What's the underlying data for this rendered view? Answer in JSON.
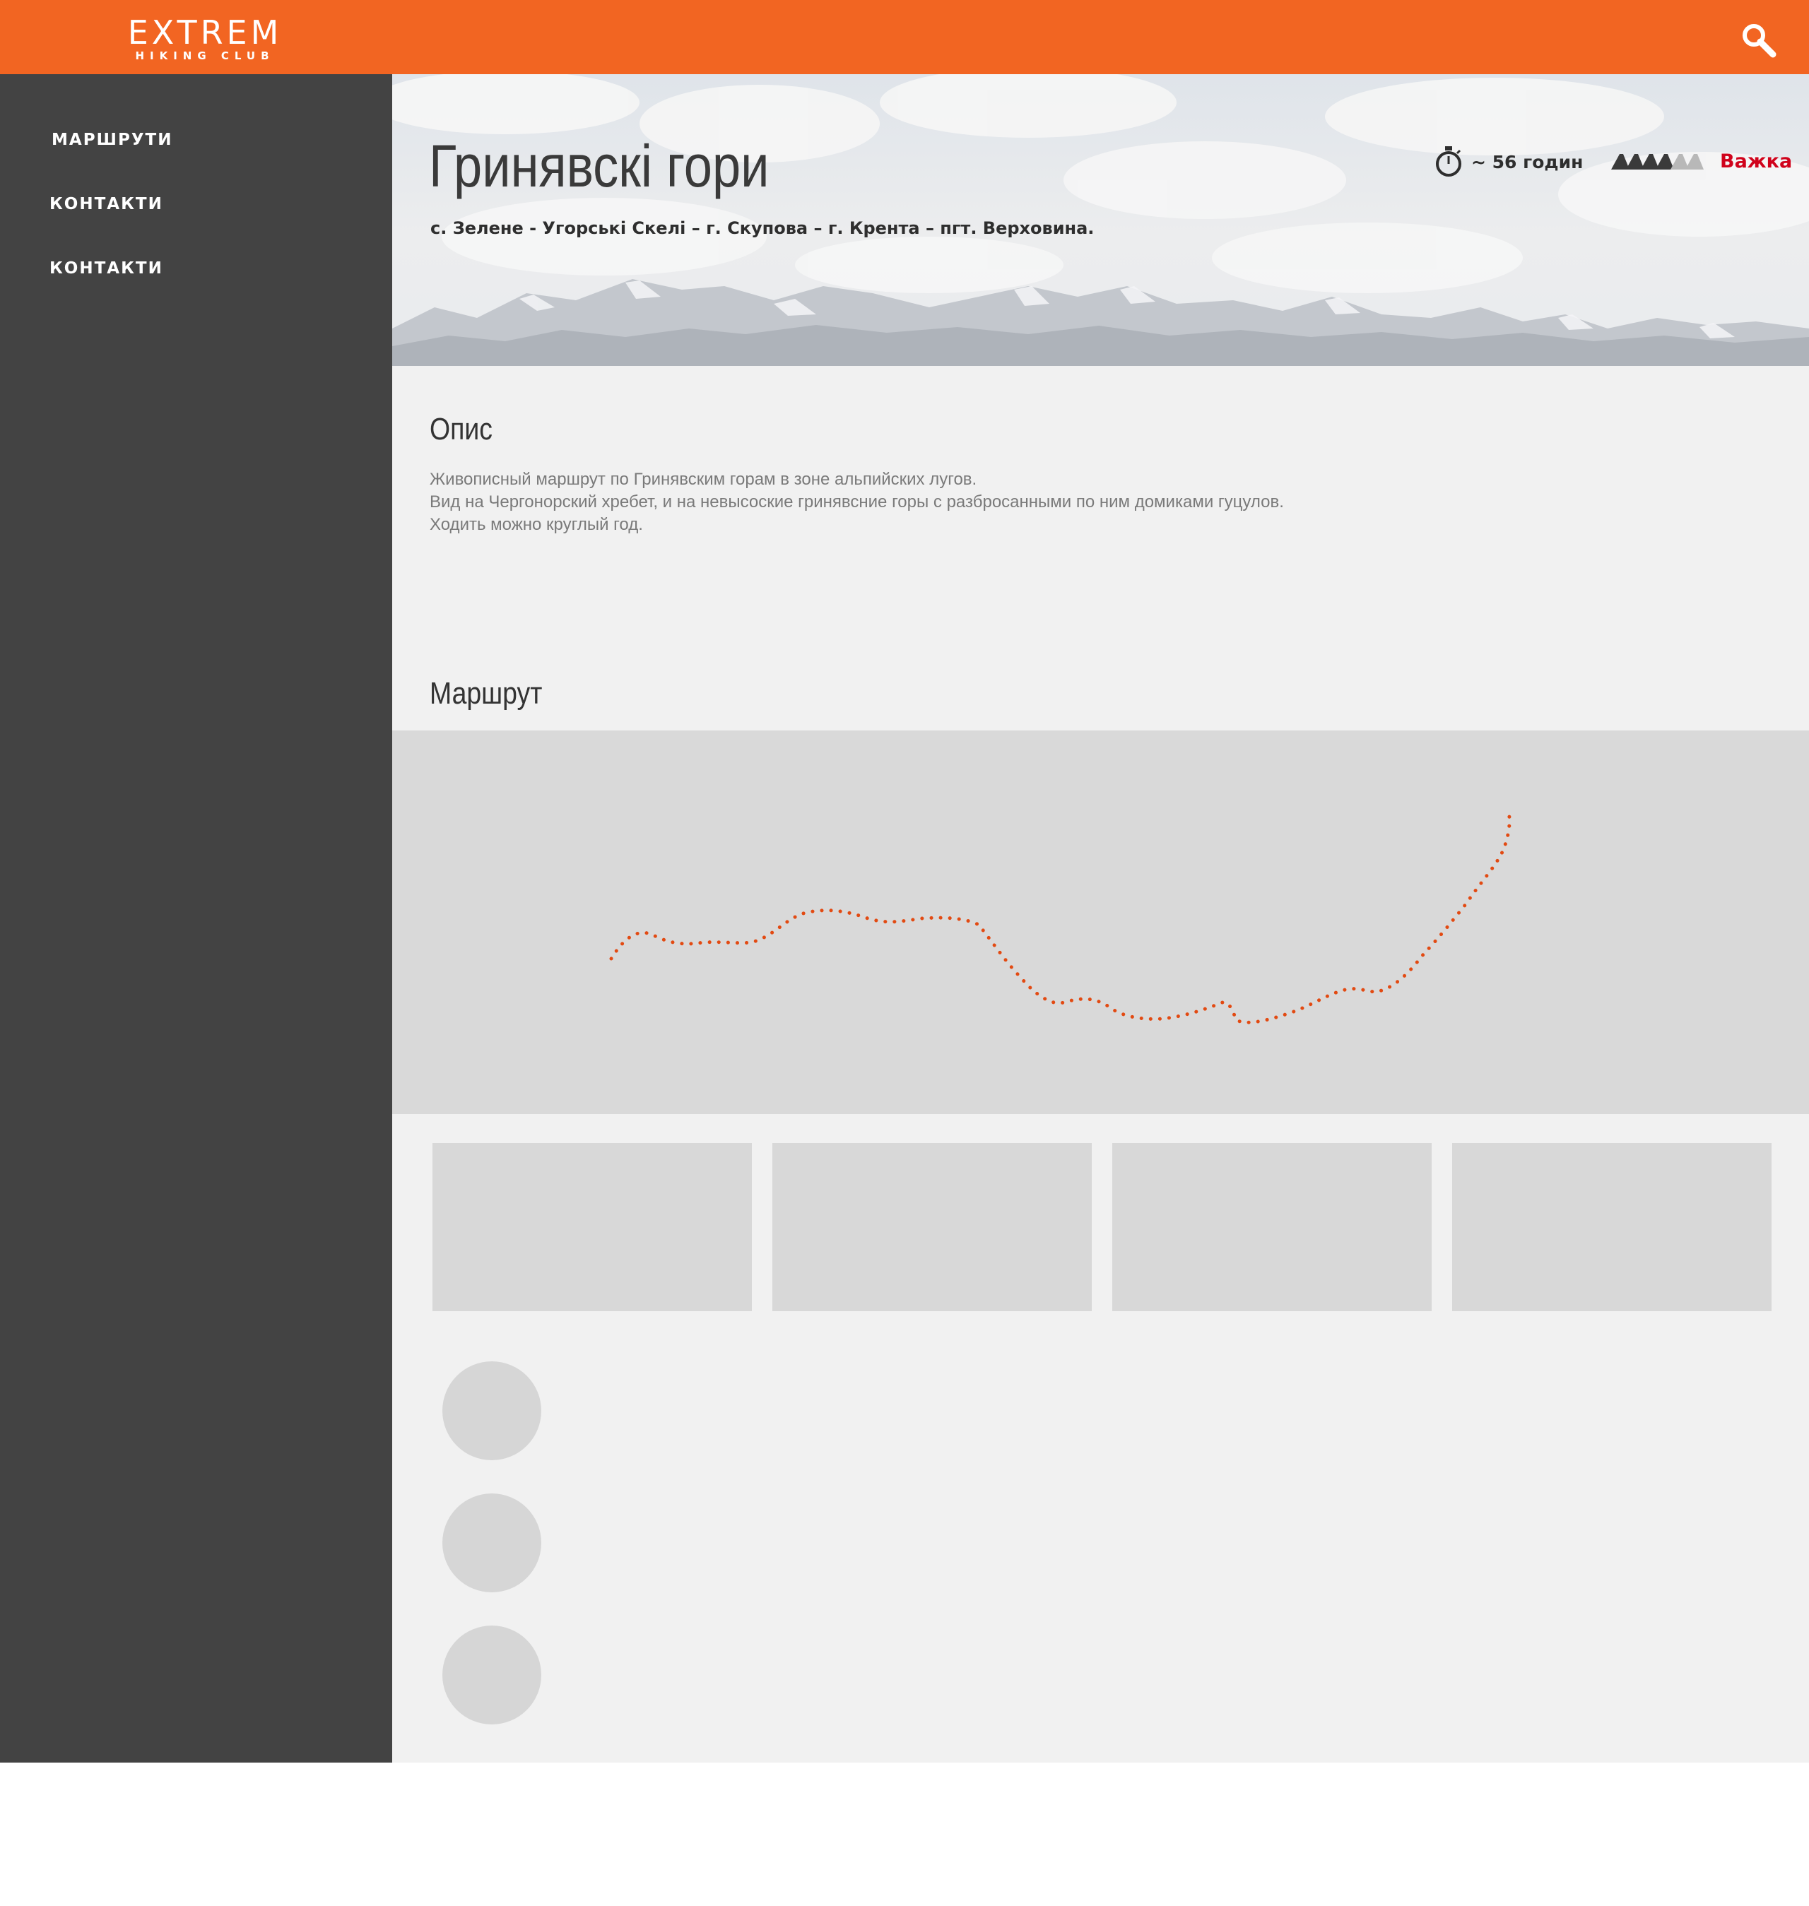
{
  "header": {
    "logo_main": "EXTREM",
    "logo_sub": "HIKING CLUB",
    "search_icon": "search-icon",
    "background": "#f26522"
  },
  "sidebar": {
    "items": [
      {
        "label": "МАРШРУТИ"
      },
      {
        "label": "КОНТАКТИ"
      },
      {
        "label": "КОНТАКТИ"
      }
    ]
  },
  "hero": {
    "title": "Гринявскі гори",
    "route": "с. Зелене - Угорські Скелі – г. Скупова – г. Крента – пгт. Верховина.",
    "time": "~ 56 годин",
    "time_icon": "stopwatch-icon",
    "difficulty_label": "Важка",
    "difficulty_level": 4,
    "difficulty_max": 6,
    "difficulty_icon": "mountain-icon",
    "difficulty_color": "#d0021b"
  },
  "description": {
    "title": "Опис",
    "lines": [
      "Живописный маршрут по Гринявским горам в зоне альпийских лугов.",
      "Вид на Чергонорский хребет, и на невысоские гринявсние горы с разбросанными по ним домиками гуцулов.",
      "Ходить можно круглый год."
    ]
  },
  "route": {
    "title": "Маршрут",
    "line_color": "#e24a12"
  }
}
